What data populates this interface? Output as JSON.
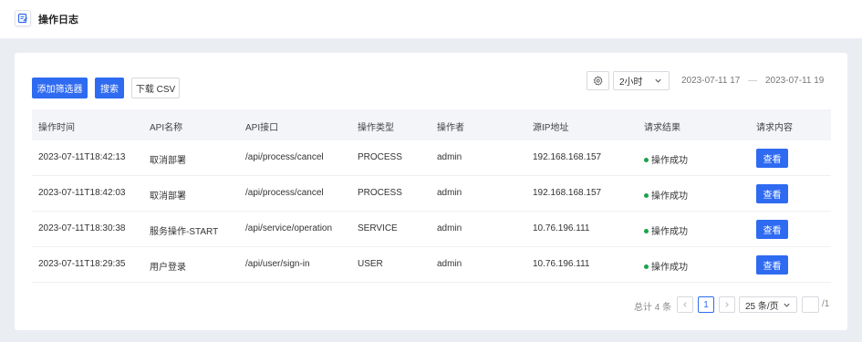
{
  "header": {
    "title": "操作日志",
    "icon": "edit-log-icon"
  },
  "toolbar": {
    "add_filter_label": "添加筛选器",
    "search_label": "搜索",
    "download_label": "下载 CSV",
    "settings_icon": "gear-icon",
    "range_value": "2小时",
    "date_start": "2023-07-11 17",
    "date_sep": "—",
    "date_end": "2023-07-11 19"
  },
  "table": {
    "columns": [
      "操作时间",
      "API名称",
      "API接口",
      "操作类型",
      "操作者",
      "源IP地址",
      "请求结果",
      "请求内容"
    ],
    "rows": [
      {
        "time": "2023-07-11T18:42:13",
        "name": "取消部署",
        "api": "/api/process/cancel",
        "type": "PROCESS",
        "operator": "admin",
        "ip": "192.168.168.157",
        "result": "操作成功",
        "action": "查看"
      },
      {
        "time": "2023-07-11T18:42:03",
        "name": "取消部署",
        "api": "/api/process/cancel",
        "type": "PROCESS",
        "operator": "admin",
        "ip": "192.168.168.157",
        "result": "操作成功",
        "action": "查看"
      },
      {
        "time": "2023-07-11T18:30:38",
        "name": "服务操作-START",
        "api": "/api/service/operation",
        "type": "SERVICE",
        "operator": "admin",
        "ip": "10.76.196.111",
        "result": "操作成功",
        "action": "查看"
      },
      {
        "time": "2023-07-11T18:29:35",
        "name": "用户登录",
        "api": "/api/user/sign-in",
        "type": "USER",
        "operator": "admin",
        "ip": "10.76.196.111",
        "result": "操作成功",
        "action": "查看"
      }
    ],
    "success_color": "#1aa34a"
  },
  "pagination": {
    "total": "总计 4 条",
    "current_page": "1",
    "page_size": "25 条/页",
    "page_count": "/1"
  },
  "colors": {
    "accent": "#2f6bf1",
    "background": "#eaedf2"
  }
}
